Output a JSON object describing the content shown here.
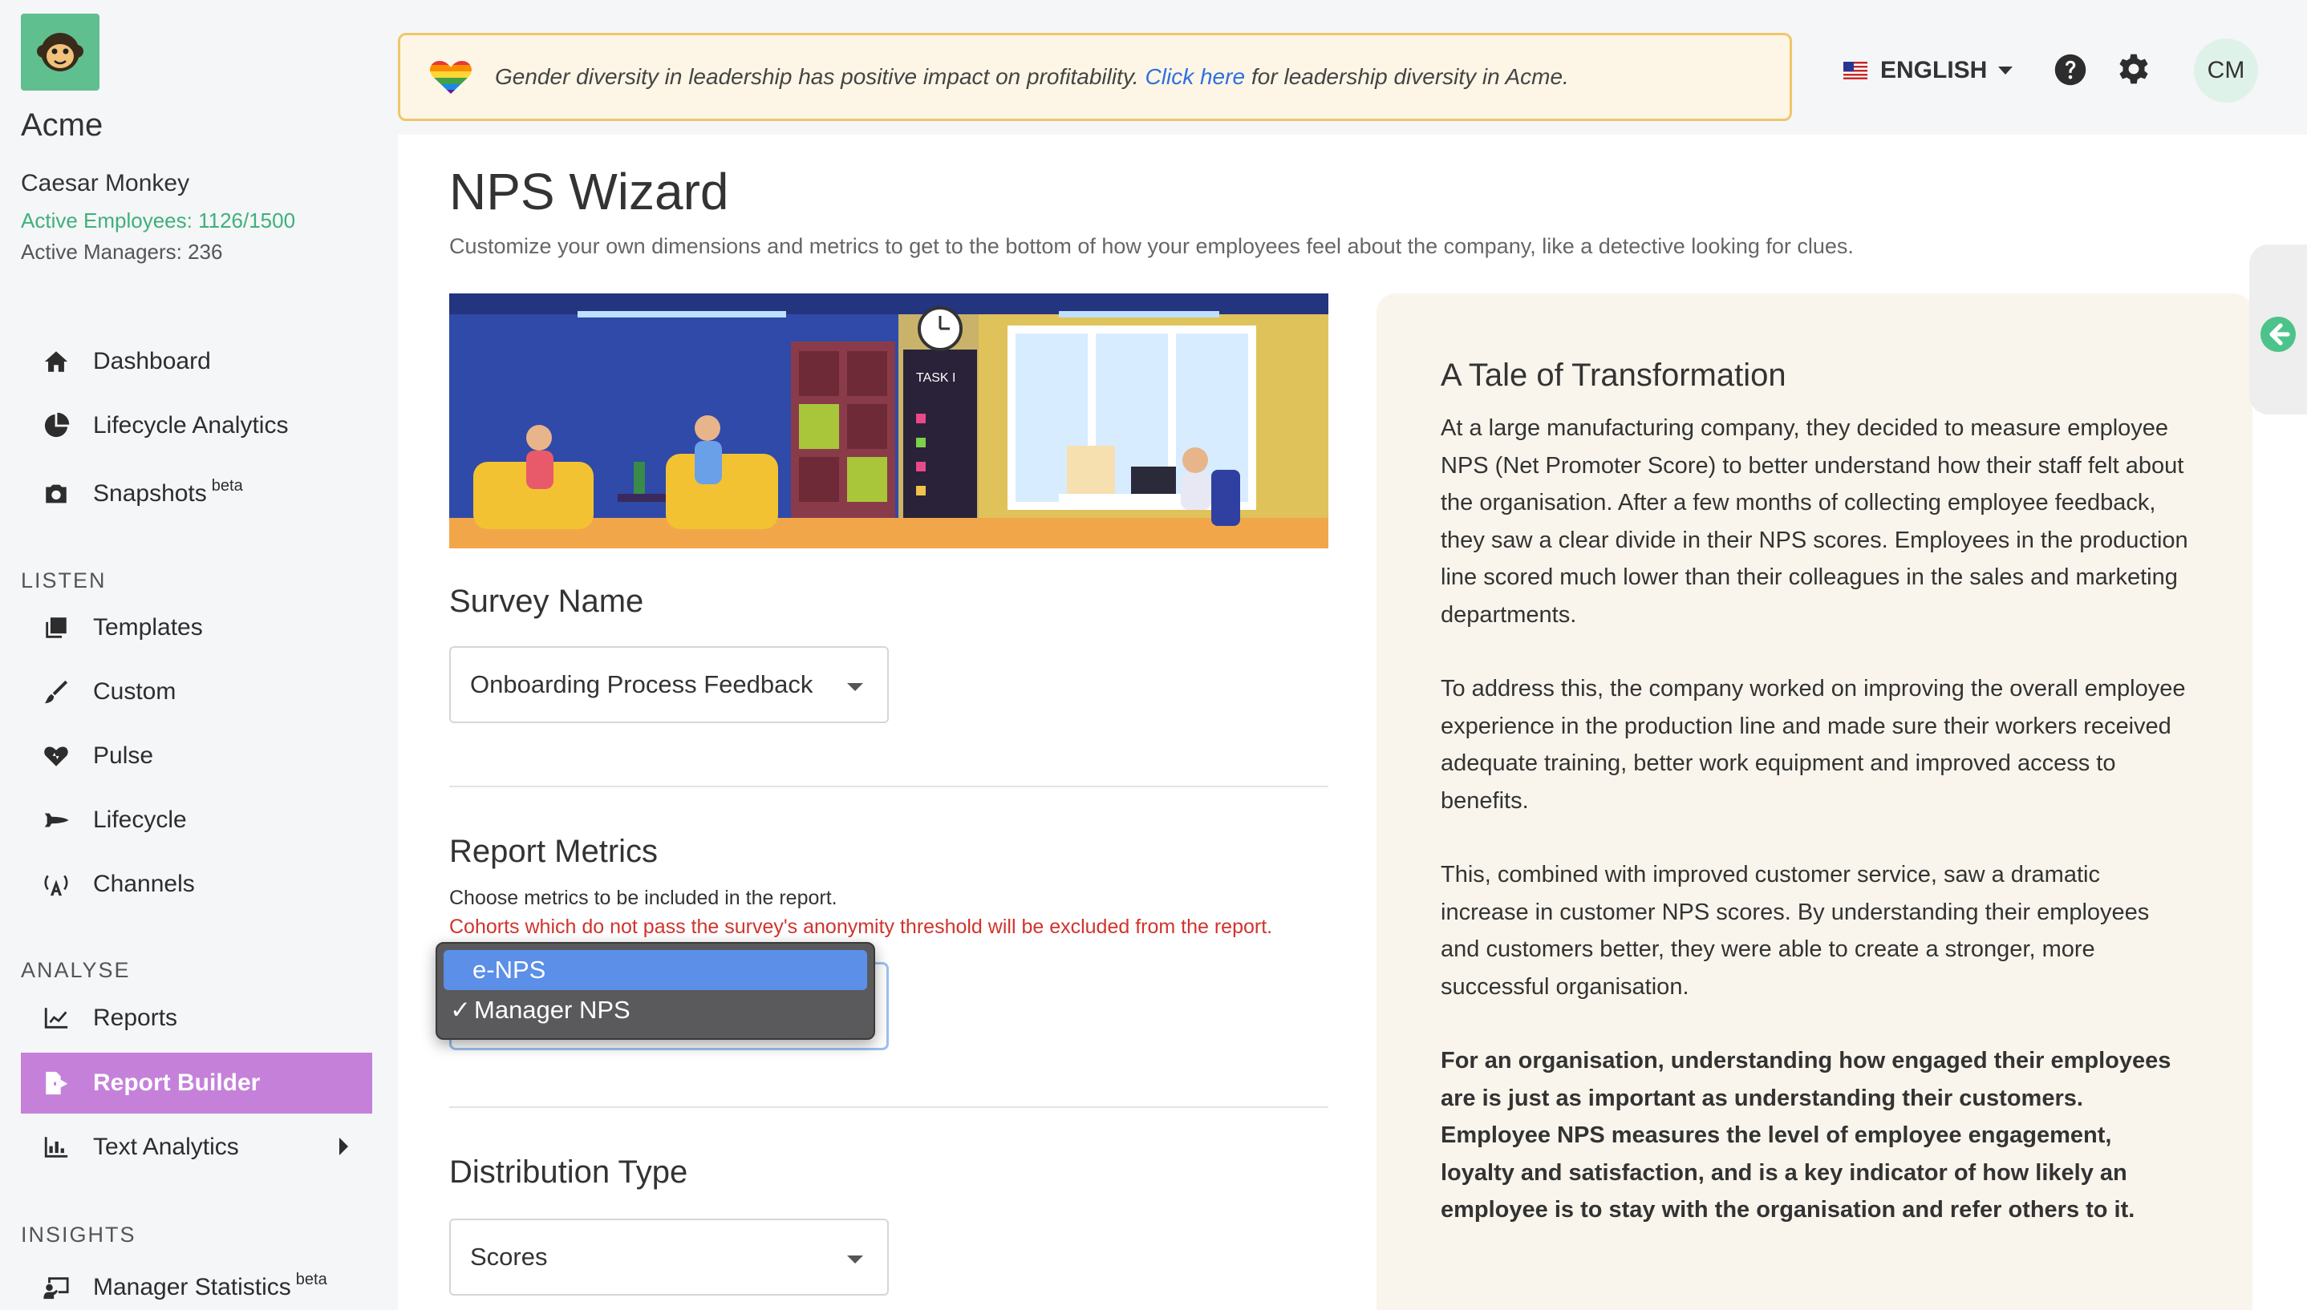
{
  "sidebar": {
    "org_name": "Acme",
    "user_name": "Caesar Monkey",
    "active_employees": "Active Employees: 1126/1500",
    "active_managers": "Active Managers: 236",
    "items_top": [
      {
        "label": "Dashboard",
        "icon": "home-icon"
      },
      {
        "label": "Lifecycle Analytics",
        "icon": "pie-chart-icon"
      },
      {
        "label": "Snapshots",
        "icon": "camera-icon",
        "badge": "beta"
      }
    ],
    "sections": {
      "listen": "LISTEN",
      "analyse": "ANALYSE",
      "insights": "INSIGHTS"
    },
    "listen_items": [
      {
        "label": "Templates",
        "icon": "copy-icon"
      },
      {
        "label": "Custom",
        "icon": "brush-icon"
      },
      {
        "label": "Pulse",
        "icon": "heartbeat-icon"
      },
      {
        "label": "Lifecycle",
        "icon": "space-shuttle-icon"
      },
      {
        "label": "Channels",
        "icon": "broadcast-icon"
      }
    ],
    "analyse_items": [
      {
        "label": "Reports",
        "icon": "line-chart-icon"
      },
      {
        "label": "Report Builder",
        "icon": "file-export-icon",
        "active": true
      },
      {
        "label": "Text Analytics",
        "icon": "bar-chart-icon"
      }
    ],
    "insights_items": [
      {
        "label": "Manager Statistics",
        "icon": "presenter-icon",
        "badge": "beta"
      }
    ]
  },
  "banner": {
    "text_before": "Gender diversity in leadership has positive impact on profitability.",
    "link": "Click here",
    "text_after": "for leadership diversity in Acme."
  },
  "topbar": {
    "language": "ENGLISH",
    "avatar_initials": "CM"
  },
  "main": {
    "title": "NPS Wizard",
    "subtitle": "Customize your own dimensions and metrics to get to the bottom of how your employees feel about the company, like a detective looking for clues.",
    "hero_label": "TASK I",
    "survey_name": {
      "label": "Survey Name",
      "value": "Onboarding Process Feedback"
    },
    "report_metrics": {
      "label": "Report Metrics",
      "help": "Choose metrics to be included in the report.",
      "warning": "Cohorts which do not pass the survey's anonymity threshold will be excluded from the report.",
      "options": [
        {
          "label": "e-NPS",
          "highlighted": true,
          "checked": false
        },
        {
          "label": "Manager NPS",
          "highlighted": false,
          "checked": true
        }
      ]
    },
    "distribution_type": {
      "label": "Distribution Type",
      "value": "Scores"
    }
  },
  "story": {
    "title": "A Tale of Transformation",
    "p1": "At a large manufacturing company, they decided to measure employee NPS (Net Promoter Score) to better understand how their staff felt about the organisation. After a few months of collecting employee feedback, they saw a clear divide in their NPS scores. Employees in the production line scored much lower than their colleagues in the sales and marketing departments.",
    "p2": "To address this, the company worked on improving the overall employee experience in the production line and made sure their workers received adequate training, better work equipment and improved access to benefits.",
    "p3": "This, combined with improved customer service, saw a dramatic increase in customer NPS scores. By understanding their employees and customers better, they were able to create a stronger, more successful organisation.",
    "p4": "For an organisation, understanding how engaged their employees are is just as important as understanding their customers. Employee NPS measures the level of employee engagement, loyalty and satisfaction, and is a key indicator of how likely an employee is to stay with the organisation and refer others to it."
  },
  "colors": {
    "accent_active": "#c581d9",
    "brand_green": "#5fbf8f",
    "link_blue": "#2f6fe0",
    "warning_red": "#d0342c",
    "banner_border": "#f0c66a",
    "story_bg": "#f9f5ec"
  }
}
